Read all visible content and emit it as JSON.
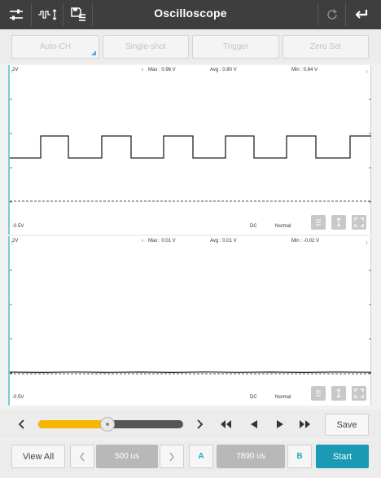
{
  "titlebar": {
    "title": "Oscilloscope",
    "icons": [
      "adjust-sliders-icon",
      "waveform-toggle-icon",
      "save-list-icon",
      "refresh-icon",
      "back-icon"
    ]
  },
  "modes": [
    {
      "label": "Auto-CH",
      "has_dropdown": true
    },
    {
      "label": "Single-shot",
      "has_dropdown": false
    },
    {
      "label": "Trigger",
      "has_dropdown": false
    },
    {
      "label": "Zero Set",
      "has_dropdown": false
    }
  ],
  "channels": [
    {
      "scale_top": "2V",
      "scale_bottom": "-0.5V",
      "max": "Max : 0.96 V",
      "avg": "Avg : 0.80 V",
      "min": "Min : 0.64 V",
      "coupling": "DC",
      "mode": "Normal",
      "signal": "square"
    },
    {
      "scale_top": "2V",
      "scale_bottom": "-0.5V",
      "max": "Max : 0.01 V",
      "avg": "Avg : 0.01 V",
      "min": "Min : -0.02 V",
      "coupling": "DC",
      "mode": "Normal",
      "signal": "flat"
    }
  ],
  "playback": {
    "slider_fraction": 0.48,
    "save_label": "Save",
    "icons": [
      "prev-icon",
      "next-icon",
      "rewind-icon",
      "step-back-icon",
      "play-icon",
      "fast-forward-icon"
    ]
  },
  "bottom": {
    "view_all_label": "View All",
    "timebase": "500 us",
    "cursor_a_label": "A",
    "cursor_value": "7890 us",
    "cursor_b_label": "B",
    "start_label": "Start"
  },
  "colors": {
    "titlebar": "#3e3e3e",
    "accent": "#1a9ab3",
    "slider_fill": "#f5b600",
    "panel_border": "#7cc9de"
  }
}
